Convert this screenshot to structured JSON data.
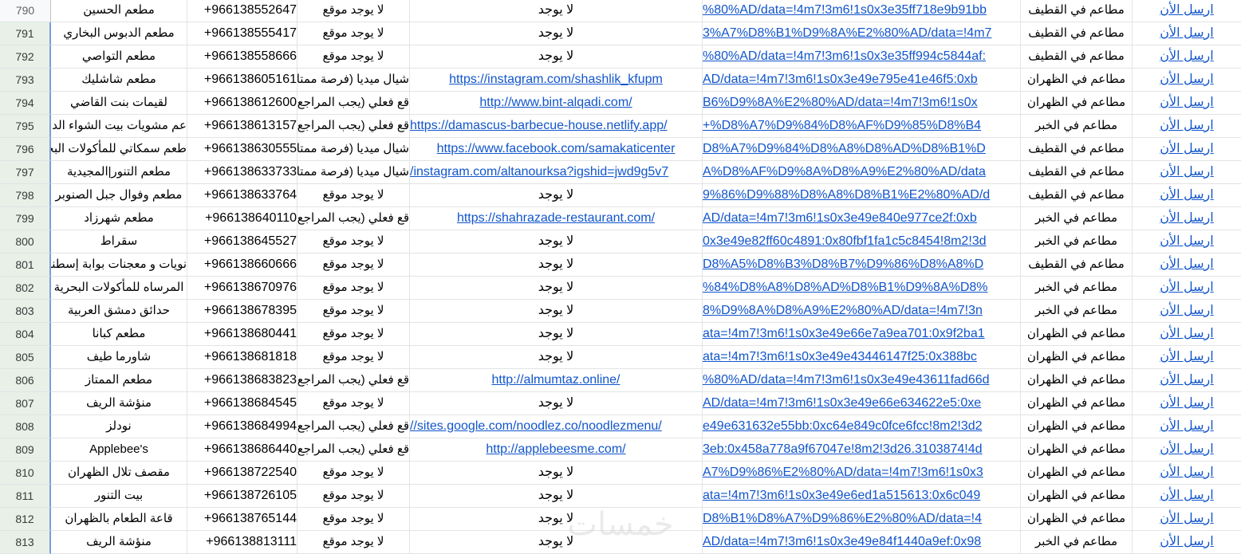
{
  "rows": [
    {
      "num": "790",
      "name": "مطعم الحسين",
      "phone": "+966138552647",
      "site_status": "لا يوجد موقع",
      "url": "لا يوجد",
      "url_is_link": false,
      "maps": "%80%AD/data=!4m7!3m6!1s0x3e35ff718e9b91bb",
      "city": "مطاعم في القطيف",
      "send": "ارسل الأن"
    },
    {
      "num": "791",
      "name": "مطعم الدبوس البخاري",
      "phone": "+966138555417",
      "site_status": "لا يوجد موقع",
      "url": "لا يوجد",
      "url_is_link": false,
      "maps": "3%A7%D8%B1%D9%8A%E2%80%AD/data=!4m7",
      "city": "مطاعم في القطيف",
      "send": "ارسل الأن"
    },
    {
      "num": "792",
      "name": "مطعم التواصي",
      "phone": "+966138558666",
      "site_status": "لا يوجد موقع",
      "url": "لا يوجد",
      "url_is_link": false,
      "maps": "%80%AD/data=!4m7!3m6!1s0x3e35ff994c5844af:",
      "city": "مطاعم في القطيف",
      "send": "ارسل الأن"
    },
    {
      "num": "793",
      "name": "مطعم شاشليك",
      "phone": "+966138605161",
      "site_status": "شيال ميديا (فرصة ممتاز",
      "url": "https://instagram.com/shashlik_kfupm",
      "url_is_link": true,
      "maps": "AD/data=!4m7!3m6!1s0x3e49e795e41e46f5:0xb",
      "city": "مطاعم في الظهران",
      "send": "ارسل الأن"
    },
    {
      "num": "794",
      "name": "لقيمات بنت القاضي",
      "phone": "+966138612600",
      "site_status": "قع فعلي (يجب المراجع",
      "url": "http://www.bint-alqadi.com/",
      "url_is_link": true,
      "maps": "B6%D9%8A%E2%80%AD/data=!4m7!3m6!1s0x",
      "city": "مطاعم في الظهران",
      "send": "ارسل الأن"
    },
    {
      "num": "795",
      "name": "عم مشويات بيت الشواء الدمشق",
      "phone": "+966138613157",
      "site_status": "قع فعلي (يجب المراجع",
      "url": "https://damascus-barbecue-house.netlify.app/",
      "url_is_link": true,
      "maps": "+%D8%A7%D9%84%D8%AF%D9%85%D8%B4",
      "city": "مطاعم في الخبر",
      "send": "ارسل الأن"
    },
    {
      "num": "796",
      "name": "طعم سمكاتي للمأكولات البحرية",
      "phone": "+966138630555",
      "site_status": "شيال ميديا (فرصة ممتاز",
      "url": "https://www.facebook.com/samakaticenter",
      "url_is_link": true,
      "maps": "D8%A7%D9%84%D8%A8%D8%AD%D8%B1%D",
      "city": "مطاعم في القطيف",
      "send": "ارسل الأن"
    },
    {
      "num": "797",
      "name": "مطعم التنور|المجيدية",
      "phone": "+966138633733",
      "site_status": "شيال ميديا (فرصة ممتاز",
      "url": "/instagram.com/altanourksa?igshid=jwd9g5v7",
      "url_is_link": true,
      "maps": "A%D8%AF%D9%8A%D8%A9%E2%80%AD/data",
      "city": "مطاعم في القطيف",
      "send": "ارسل الأن"
    },
    {
      "num": "798",
      "name": "مطعم وفوال جبل الصنوبر",
      "phone": "+966138633764",
      "site_status": "لا يوجد موقع",
      "url": "لا يوجد",
      "url_is_link": false,
      "maps": "9%86%D9%88%D8%A8%D8%B1%E2%80%AD/d",
      "city": "مطاعم في القطيف",
      "send": "ارسل الأن"
    },
    {
      "num": "799",
      "name": "مطعم شهرزاد",
      "phone": "+966138640110",
      "site_status": "قع فعلي (يجب المراجع",
      "url": "https://shahrazade-restaurant.com/",
      "url_is_link": true,
      "maps": "AD/data=!4m7!3m6!1s0x3e49e840e977ce2f:0xb",
      "city": "مطاعم في الخبر",
      "send": "ارسل الأن"
    },
    {
      "num": "800",
      "name": "سقراط",
      "phone": "+966138645527",
      "site_status": "لا يوجد موقع",
      "url": "لا يوجد",
      "url_is_link": false,
      "maps": "0x3e49e82ff60c4891:0x80fbf1fa1c5c8454!8m2!3d",
      "city": "مطاعم في الخبر",
      "send": "ارسل الأن"
    },
    {
      "num": "801",
      "name": "نويات و معجنات بوابة إسطنبو",
      "phone": "+966138660666",
      "site_status": "لا يوجد موقع",
      "url": "لا يوجد",
      "url_is_link": false,
      "maps": "D8%A5%D8%B3%D8%B7%D9%86%D8%A8%D",
      "city": "مطاعم في القطيف",
      "send": "ارسل الأن"
    },
    {
      "num": "802",
      "name": "المرساه للمأكولات البحرية",
      "phone": "+966138670976",
      "site_status": "لا يوجد موقع",
      "url": "لا يوجد",
      "url_is_link": false,
      "maps": "%84%D8%A8%D8%AD%D8%B1%D9%8A%D8%",
      "city": "مطاعم في الخبر",
      "send": "ارسل الأن"
    },
    {
      "num": "803",
      "name": "حدائق دمشق العربية",
      "phone": "+966138678395",
      "site_status": "لا يوجد موقع",
      "url": "لا يوجد",
      "url_is_link": false,
      "maps": "8%D9%8A%D8%A9%E2%80%AD/data=!4m7!3n",
      "city": "مطاعم في الخبر",
      "send": "ارسل الأن"
    },
    {
      "num": "804",
      "name": "مطعم كبانا",
      "phone": "+966138680441",
      "site_status": "لا يوجد موقع",
      "url": "لا يوجد",
      "url_is_link": false,
      "maps": "ata=!4m7!3m6!1s0x3e49e66e7a9ea701:0x9f2ba1",
      "city": "مطاعم في الظهران",
      "send": "ارسل الأن"
    },
    {
      "num": "805",
      "name": "شاورما طيف",
      "phone": "+966138681818",
      "site_status": "لا يوجد موقع",
      "url": "لا يوجد",
      "url_is_link": false,
      "maps": "ata=!4m7!3m6!1s0x3e49e43446147f25:0x388bc",
      "city": "مطاعم في الظهران",
      "send": "ارسل الأن"
    },
    {
      "num": "806",
      "name": "مطعم الممتاز",
      "phone": "+966138683823",
      "site_status": "قع فعلي (يجب المراجع",
      "url": "http://almumtaz.online/",
      "url_is_link": true,
      "maps": "%80%AD/data=!4m7!3m6!1s0x3e49e43611fad66d",
      "city": "مطاعم في الظهران",
      "send": "ارسل الأن"
    },
    {
      "num": "807",
      "name": "منؤشة الريف",
      "phone": "+966138684545",
      "site_status": "لا يوجد موقع",
      "url": "لا يوجد",
      "url_is_link": false,
      "maps": "AD/data=!4m7!3m6!1s0x3e49e66e634622e5:0xe",
      "city": "مطاعم في الظهران",
      "send": "ارسل الأن"
    },
    {
      "num": "808",
      "name": "نودلز",
      "phone": "+966138684994",
      "site_status": "قع فعلي (يجب المراجع",
      "url": "//sites.google.com/noodlez.co/noodlezmenu/",
      "url_is_link": true,
      "maps": "e49e631632e55bb:0xc64e849c0fce6fcc!8m2!3d2",
      "city": "مطاعم في الظهران",
      "send": "ارسل الأن"
    },
    {
      "num": "809",
      "name": "Applebee's",
      "phone": "+966138686440",
      "site_status": "قع فعلي (يجب المراجع",
      "url": "http://applebeesme.com/",
      "url_is_link": true,
      "maps": "3eb:0x458a778a9f67047e!8m2!3d26.3103874!4d",
      "city": "مطاعم في الظهران",
      "send": "ارسل الأن"
    },
    {
      "num": "810",
      "name": "مقصف تلال الظهران",
      "phone": "+966138722540",
      "site_status": "لا يوجد موقع",
      "url": "لا يوجد",
      "url_is_link": false,
      "maps": "A7%D9%86%E2%80%AD/data=!4m7!3m6!1s0x3",
      "city": "مطاعم في الظهران",
      "send": "ارسل الأن"
    },
    {
      "num": "811",
      "name": "بيت التنور",
      "phone": "+966138726105",
      "site_status": "لا يوجد موقع",
      "url": "لا يوجد",
      "url_is_link": false,
      "maps": "ata=!4m7!3m6!1s0x3e49e6ed1a515613:0x6c049",
      "city": "مطاعم في الظهران",
      "send": "ارسل الأن"
    },
    {
      "num": "812",
      "name": "قاعة الطعام بالظهران",
      "phone": "+966138765144",
      "site_status": "لا يوجد موقع",
      "url": "لا يوجد",
      "url_is_link": false,
      "maps": "D8%B1%D8%A7%D9%86%E2%80%AD/data=!4",
      "city": "مطاعم في الظهران",
      "send": "ارسل الأن"
    },
    {
      "num": "813",
      "name": "منؤشة الريف",
      "phone": "+966138813111",
      "site_status": "لا يوجد موقع",
      "url": "لا يوجد",
      "url_is_link": false,
      "maps": "AD/data=!4m7!3m6!1s0x3e49e84f1440a9ef:0x98",
      "city": "مطاعم في الخبر",
      "send": "ارسل الأن"
    }
  ],
  "watermark": "خمسات",
  "colors": {
    "link": "#1155cc",
    "grid": "#e2e3e3",
    "row_header_bg": "#f8f9fa"
  }
}
